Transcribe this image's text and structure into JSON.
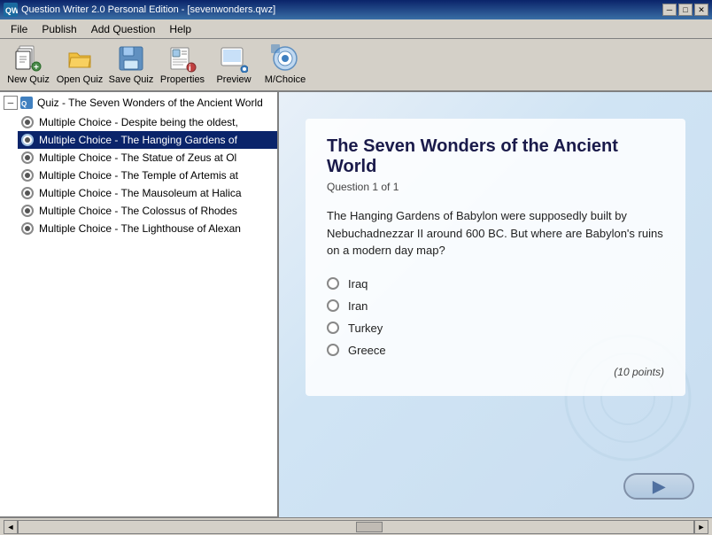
{
  "window": {
    "title": "Question Writer 2.0 Personal Edition - [sevenwonders.qwz]",
    "icon": "qw-icon"
  },
  "titlebar": {
    "title": "Question Writer 2.0 Personal Edition - [sevenwonders.qwz]",
    "minimize_label": "─",
    "maximize_label": "□",
    "close_label": "✕"
  },
  "menubar": {
    "items": [
      {
        "label": "File",
        "id": "file"
      },
      {
        "label": "Publish",
        "id": "publish"
      },
      {
        "label": "Add Question",
        "id": "add-question"
      },
      {
        "label": "Help",
        "id": "help"
      }
    ]
  },
  "toolbar": {
    "buttons": [
      {
        "id": "new-quiz",
        "label": "New Quiz"
      },
      {
        "id": "open-quiz",
        "label": "Open Quiz"
      },
      {
        "id": "save-quiz",
        "label": "Save Quiz"
      },
      {
        "id": "properties",
        "label": "Properties"
      },
      {
        "id": "preview",
        "label": "Preview"
      },
      {
        "id": "mchoice",
        "label": "M/Choice"
      }
    ]
  },
  "tree": {
    "root": {
      "label": "Quiz - The Seven Wonders of the Ancient World",
      "collapsed": false
    },
    "items": [
      {
        "label": "Multiple Choice - Despite being the oldest,",
        "selected": false
      },
      {
        "label": "Multiple Choice - The Hanging Gardens of",
        "selected": true
      },
      {
        "label": "Multiple Choice - The Statue of Zeus at Ol",
        "selected": false
      },
      {
        "label": "Multiple Choice - The Temple of Artemis at",
        "selected": false
      },
      {
        "label": "Multiple Choice - The Mausoleum at Halica",
        "selected": false
      },
      {
        "label": "Multiple Choice - The Colossus of Rhodes",
        "selected": false
      },
      {
        "label": "Multiple Choice - The Lighthouse of Alexan",
        "selected": false
      }
    ]
  },
  "preview": {
    "title": "The Seven Wonders of the Ancient World",
    "question_number": "Question 1 of 1",
    "question_text": "The Hanging Gardens of Babylon were supposedly built by Nebuchadnezzar II around 600 BC. But where are Babylon's ruins on a modern day map?",
    "options": [
      {
        "label": "Iraq"
      },
      {
        "label": "Iran"
      },
      {
        "label": "Turkey"
      },
      {
        "label": "Greece"
      }
    ],
    "points": "(10 points)"
  },
  "statusbar": {
    "scroll_left": "◄",
    "scroll_right": "►"
  }
}
